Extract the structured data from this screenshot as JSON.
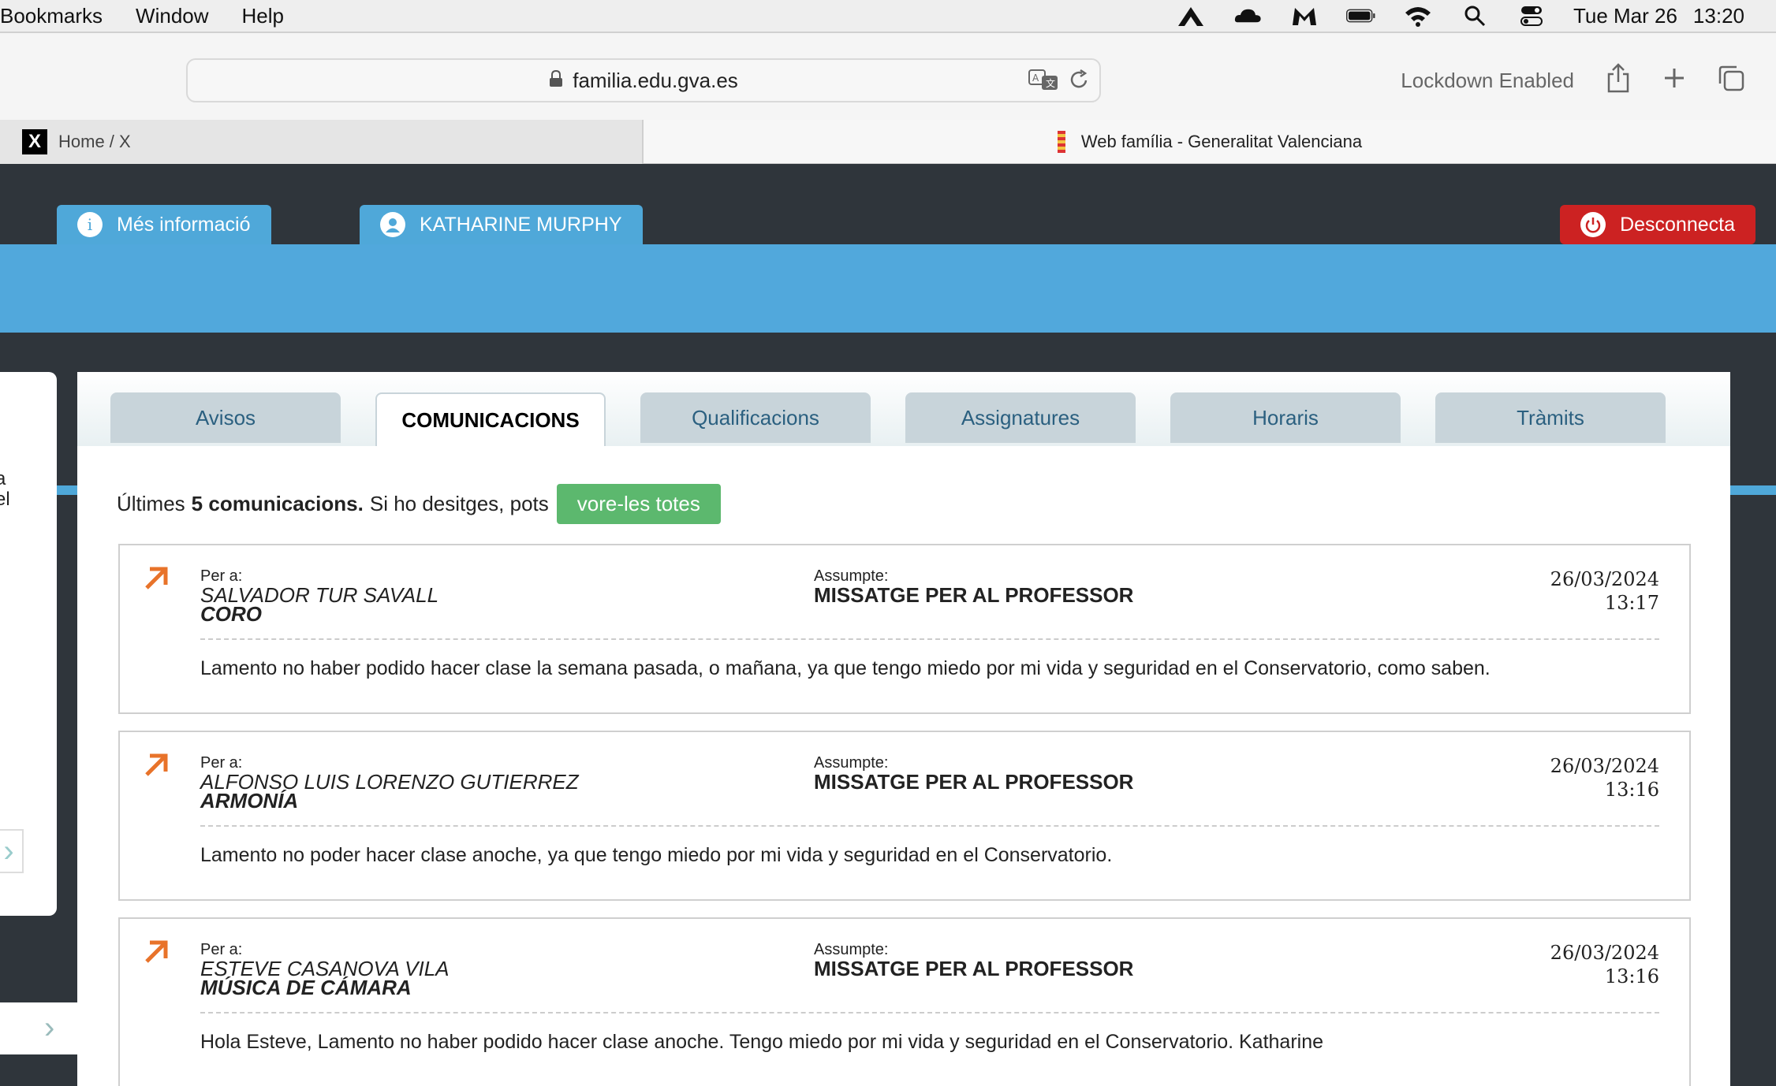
{
  "menubar": {
    "items": [
      "Bookmarks",
      "Window",
      "Help"
    ],
    "date": "Tue Mar 26",
    "time": "13:20"
  },
  "browser": {
    "url": "familia.edu.gva.es",
    "lockdown": "Lockdown Enabled",
    "tabs": [
      {
        "title": "Home / X"
      },
      {
        "title": "Web família - Generalitat Valenciana"
      }
    ]
  },
  "header": {
    "info_label": "Més informació",
    "user_label": "KATHARINE MURPHY",
    "logout_label": "Desconnecta"
  },
  "sidecard": {
    "line1": "a",
    "line2": "el"
  },
  "nav": {
    "tabs": [
      {
        "label": "Avisos",
        "active": false
      },
      {
        "label": "COMUNICACIONS",
        "active": true
      },
      {
        "label": "Qualificacions",
        "active": false
      },
      {
        "label": "Assignatures",
        "active": false
      },
      {
        "label": "Horaris",
        "active": false
      },
      {
        "label": "Tràmits",
        "active": false
      }
    ]
  },
  "summary": {
    "prefix": "Últimes",
    "bold": "5 comunicacions.",
    "suffix": "Si ho desitges, pots",
    "button": "vore-les totes"
  },
  "messages": [
    {
      "per_label": "Per a:",
      "recipient": "SALVADOR TUR SAVALL",
      "course": "CORO",
      "assumpte_label": "Assumpte:",
      "assumpte": "MISSATGE PER AL PROFESSOR",
      "date": "26/03/2024",
      "time": "13:17",
      "body": "Lamento no haber podido hacer clase la semana pasada, o mañana, ya que tengo miedo por mi vida y seguridad en el Conservatorio, como saben."
    },
    {
      "per_label": "Per a:",
      "recipient": "ALFONSO LUIS LORENZO GUTIERREZ",
      "course": "ARMONÍA",
      "assumpte_label": "Assumpte:",
      "assumpte": "MISSATGE PER AL PROFESSOR",
      "date": "26/03/2024",
      "time": "13:16",
      "body": "Lamento no poder hacer clase anoche, ya que tengo miedo por mi vida y seguridad en el Conservatorio."
    },
    {
      "per_label": "Per a:",
      "recipient": "ESTEVE CASANOVA VILA",
      "course": "MÚSICA DE CÁMARA",
      "assumpte_label": "Assumpte:",
      "assumpte": "MISSATGE PER AL PROFESSOR",
      "date": "26/03/2024",
      "time": "13:16",
      "body": "Hola Esteve, Lamento no haber podido hacer clase anoche. Tengo miedo por mi vida y seguridad en el Conservatorio. Katharine"
    }
  ],
  "colors": {
    "banner": "#51a8dc",
    "page_bg": "#2f353b",
    "logout": "#cc2222",
    "green": "#5cb86e",
    "arrow": "#e8732a"
  }
}
